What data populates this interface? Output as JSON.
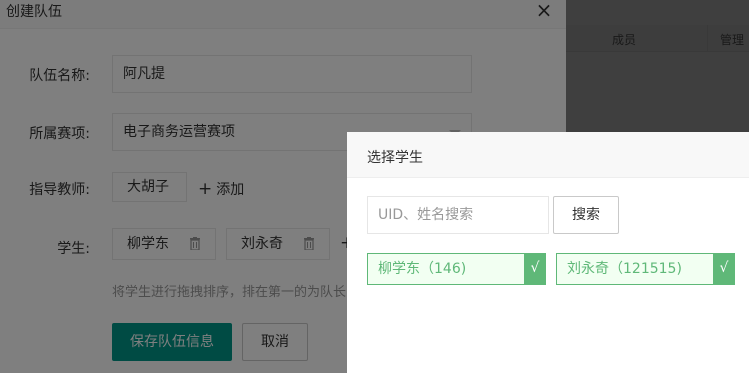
{
  "background": {
    "table_headers": [
      "成员",
      "管理"
    ]
  },
  "dialog": {
    "title": "创建队伍",
    "close_symbol": "×",
    "labels": {
      "team_name": "队伍名称:",
      "event": "所属赛项:",
      "teacher": "指导教师:",
      "student": "学生:"
    },
    "team_name_value": "阿凡提",
    "event_value": "电子商务运营赛项",
    "teacher_value": "大胡子",
    "add_label": "添加",
    "add_symbol": "+",
    "students": [
      "柳学东",
      "刘永奇"
    ],
    "hint": "将学生进行拖拽排序，排在第一的为队长",
    "save_label": "保存队伍信息",
    "cancel_label": "取消"
  },
  "popup": {
    "title": "选择学生",
    "search_placeholder": "UID、姓名搜索",
    "search_label": "搜索",
    "check_symbol": "√",
    "candidates": [
      {
        "label": "柳学东（146)"
      },
      {
        "label": "刘永奇（121515)"
      }
    ]
  },
  "colors": {
    "primary": "#009688",
    "selected_green": "#5fb878"
  }
}
